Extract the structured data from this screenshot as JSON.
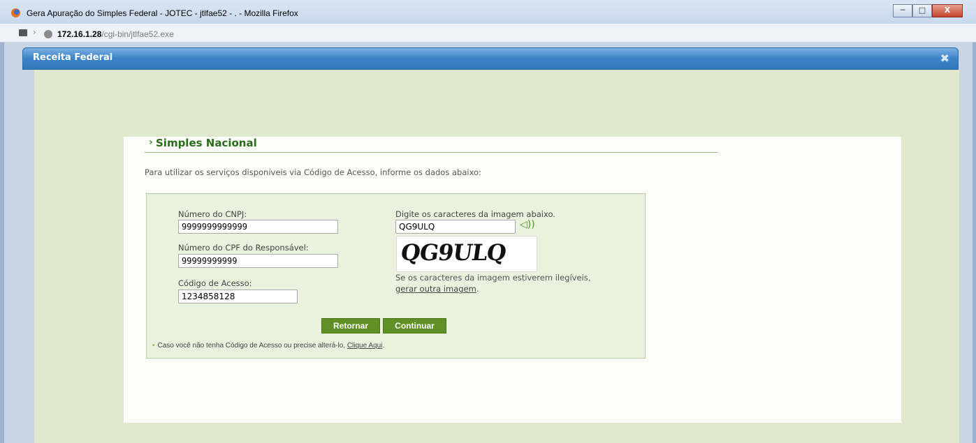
{
  "window": {
    "title": "Gera Apuração do Simples Federal - JOTEC - jtlfae52 - . - Mozilla Firefox",
    "minimize": "─",
    "maximize": "□",
    "close": "X"
  },
  "address": {
    "host": "172.16.1.28",
    "path": "/cgi-bin/jtlfae52.exe"
  },
  "dialog": {
    "title": "Receita Federal",
    "close_icon": "✖"
  },
  "section": {
    "arrow": "›",
    "title": "Simples Nacional",
    "intro": "Para utilizar os serviços disponíveis via Código de Acesso, informe os dados abaixo:"
  },
  "form": {
    "cnpj_label": "Número do CNPJ:",
    "cnpj_value": "9999999999999",
    "cpf_label": "Número do CPF do Responsável:",
    "cpf_value": "99999999999",
    "code_label": "Código de Acesso:",
    "code_value": "1234858128",
    "captcha_label": "Digite os caracteres da imagem abaixo.",
    "captcha_value": "QG9ULQ",
    "captcha_image_text": "QG9ULQ",
    "captcha_hint_1": "Se os caracteres da imagem estiverem ilegíveis,",
    "captcha_hint_link": "gerar outra imagem",
    "captcha_hint_end": ".",
    "speaker_icon": "speaker-icon"
  },
  "buttons": {
    "back": "Retornar",
    "continue": "Continuar"
  },
  "footnote": {
    "bullet": "•",
    "text": "Caso você não tenha Código de Acesso ou precise alterá-lo,",
    "link": "Clique Aqui",
    "end": "."
  }
}
